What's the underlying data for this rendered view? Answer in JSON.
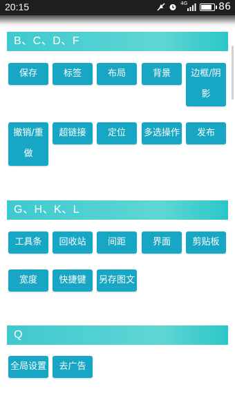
{
  "status_bar": {
    "time": "20:15",
    "network_label": "4G",
    "battery_level": "86",
    "battery_fraction": 0.86
  },
  "sections": [
    {
      "title": "B、C、D、F",
      "buttons": [
        "保存",
        "标签",
        "布局",
        "背景",
        "边框/阴影",
        "撤销/重做",
        "超链接",
        "定位",
        "多选操作",
        "发布"
      ]
    },
    {
      "title": "G、H、K、L",
      "buttons": [
        "工具条",
        "回收站",
        "间距",
        "界面",
        "剪贴板",
        "宽度",
        "快捷键",
        "另存图文"
      ]
    },
    {
      "title": "Q",
      "buttons": [
        "全局设置",
        "去广告"
      ]
    }
  ],
  "colors": {
    "header_gradient_start": "#3ec9d0",
    "header_gradient_end": "#2bc6c8",
    "button_bg": "#17a6c4",
    "button_text": "#ffffff"
  }
}
